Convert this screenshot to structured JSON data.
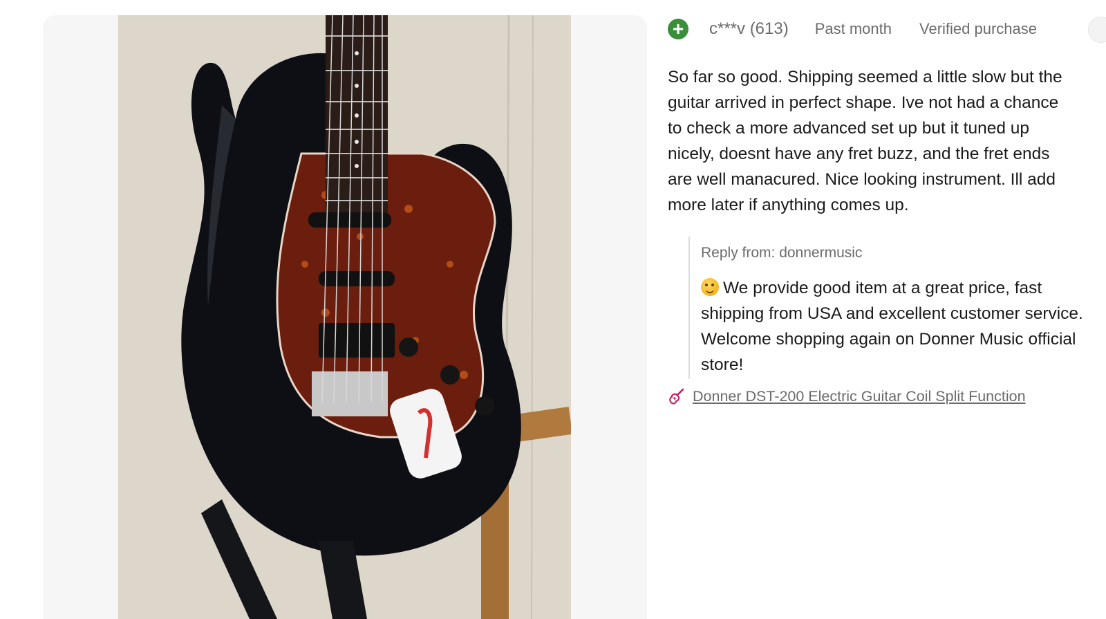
{
  "review": {
    "reviewer_name": "c***v (613)",
    "date": "Past month",
    "badge": "Verified purchase",
    "avatar_icon": "plus-icon",
    "text": "So far so good. Shipping seemed a little slow but the guitar arrived in perfect shape. Ive not had a chance to check a more advanced set up but it tuned up nicely, doesnt have any fret buzz, and the fret ends are well manacured. Nice looking instrument. Ill add more later if anything comes up."
  },
  "reply": {
    "from_label": "Reply from: donnermusic",
    "emoji_icon": "smiling-face-icon",
    "text": "We provide good item at a great price, fast shipping from USA and excellent customer service. Welcome shopping again on Donner Music official store!"
  },
  "product": {
    "icon": "guitar-icon",
    "link_text": "Donner DST-200 Electric Guitar Coil Split Function"
  },
  "colors": {
    "avatar_bg": "#3b8f3b",
    "meta_text": "#6b6b6b",
    "body_text": "#1a1a1a",
    "link_icon": "#c2185b"
  }
}
